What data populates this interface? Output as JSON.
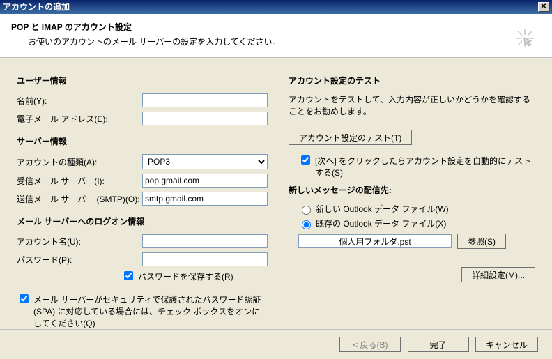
{
  "window": {
    "title": "アカウントの追加"
  },
  "header": {
    "title": "POP と IMAP のアカウント設定",
    "subtitle": "お使いのアカウントのメール サーバーの設定を入力してください。"
  },
  "userInfo": {
    "section": "ユーザー情報",
    "name_label": "名前(Y):",
    "name_value": "",
    "email_label": "電子メール アドレス(E):",
    "email_value": ""
  },
  "serverInfo": {
    "section": "サーバー情報",
    "type_label": "アカウントの種類(A):",
    "type_value": "POP3",
    "incoming_label": "受信メール サーバー(I):",
    "incoming_value": "pop.gmail.com",
    "outgoing_label": "送信メール サーバー (SMTP)(O):",
    "outgoing_value": "smtp.gmail.com"
  },
  "logon": {
    "section": "メール サーバーへのログオン情報",
    "account_label": "アカウント名(U):",
    "account_value": "",
    "password_label": "パスワード(P):",
    "password_value": "",
    "remember_label": "パスワードを保存する(R)",
    "remember_checked": true,
    "spa_label": "メール サーバーがセキュリティで保護されたパスワード認証 (SPA) に対応している場合には、チェック ボックスをオンにしてください(Q)",
    "spa_checked": true
  },
  "test": {
    "section": "アカウント設定のテスト",
    "desc": "アカウントをテストして、入力内容が正しいかどうかを確認することをお勧めします。",
    "button": "アカウント設定のテスト(T)",
    "autotest_label": "[次へ] をクリックしたらアカウント設定を自動的にテストする(S)",
    "autotest_checked": true
  },
  "delivery": {
    "section": "新しいメッセージの配信先:",
    "new_file_label": "新しい Outlook データ ファイル(W)",
    "existing_file_label": "既存の Outlook データ ファイル(X)",
    "selected": "existing",
    "path_value": "個人用フォルダ.pst",
    "browse_button": "参照(S)"
  },
  "advanced_button": "詳細設定(M)...",
  "footer": {
    "back": "< 戻る(B)",
    "finish": "完了",
    "cancel": "キャンセル"
  }
}
